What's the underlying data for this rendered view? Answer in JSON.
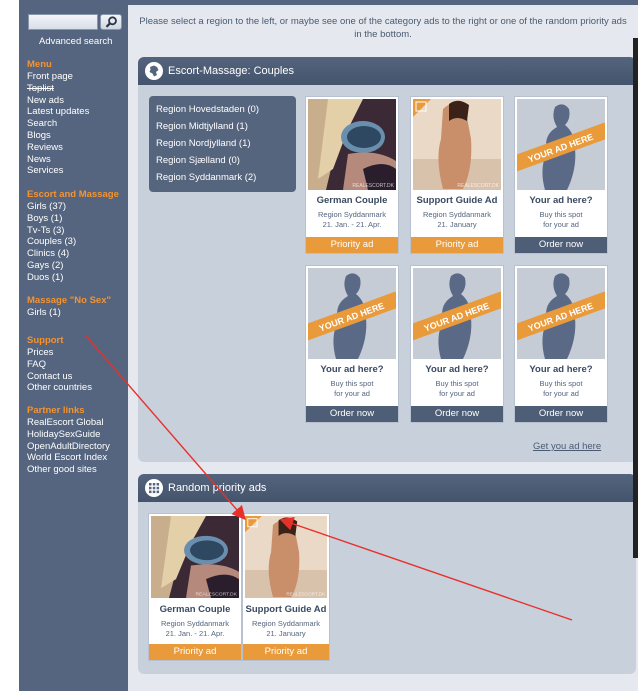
{
  "colors": {
    "accent_orange": "#f5932f",
    "sidebar_bg": "#55657f",
    "arrow_red": "#e8302a"
  },
  "search": {
    "placeholder": "",
    "advanced_label": "Advanced search"
  },
  "sidebar": {
    "menu": {
      "heading": "Menu",
      "items": [
        "Front page",
        "Toplist",
        "New ads",
        "Latest updates",
        "Search",
        "Blogs",
        "Reviews",
        "News",
        "Services"
      ]
    },
    "escort": {
      "heading": "Escort and Massage",
      "items": [
        "Girls (37)",
        "Boys (1)",
        "Tv-Ts (3)",
        "Couples (3)",
        "Clinics (4)",
        "Gays (2)",
        "Duos (1)"
      ]
    },
    "nosex": {
      "heading": "Massage \"No Sex\"",
      "items": [
        "Girls (1)"
      ]
    },
    "support": {
      "heading": "Support",
      "items": [
        "Prices",
        "FAQ",
        "Contact us",
        "Other countries"
      ]
    },
    "partners": {
      "heading": "Partner links",
      "items": [
        "RealEscort Global",
        "HolidaySexGuide",
        "OpenAdultDirectory",
        "World Escort Index",
        "Other good sites"
      ]
    }
  },
  "intro_text": "Please select a region to the left, or maybe see one of the category ads to the right or one of the random priority ads in the bottom.",
  "category_panel": {
    "title": "Escort-Massage: Couples",
    "regions": [
      "Region Hovedstaden (0)",
      "Region Midtjylland (1)",
      "Region Nordjylland (1)",
      "Region Sjælland (0)",
      "Region Syddanmark (2)"
    ],
    "cards": [
      {
        "title": "German Couple",
        "line1": "Region Syddanmark",
        "line2": "21. Jan. - 21. Apr.",
        "button": "Priority ad"
      },
      {
        "title": "Support Guide Ad",
        "line1": "Region Syddanmark",
        "line2": "21. January",
        "button": "Priority ad"
      },
      {
        "title": "Your ad here?",
        "line1": "Buy this spot",
        "line2": "for your ad",
        "button": "Order now",
        "banner": "YOUR AD HERE"
      },
      {
        "title": "Your ad here?",
        "line1": "Buy this spot",
        "line2": "for your ad",
        "button": "Order now",
        "banner": "YOUR AD HERE"
      },
      {
        "title": "Your ad here?",
        "line1": "Buy this spot",
        "line2": "for your ad",
        "button": "Order now",
        "banner": "YOUR AD HERE"
      },
      {
        "title": "Your ad here?",
        "line1": "Buy this spot",
        "line2": "for your ad",
        "button": "Order now",
        "banner": "YOUR AD HERE"
      }
    ],
    "get_ad_link": "Get you ad here"
  },
  "random_panel": {
    "title": "Random priority ads",
    "cards": [
      {
        "title": "German Couple",
        "line1": "Region Syddanmark",
        "line2": "21. Jan. - 21. Apr.",
        "button": "Priority ad"
      },
      {
        "title": "Support Guide Ad",
        "line1": "Region Syddanmark",
        "line2": "21. January",
        "button": "Priority ad"
      }
    ]
  },
  "watermark": "REALESCORT.DK"
}
